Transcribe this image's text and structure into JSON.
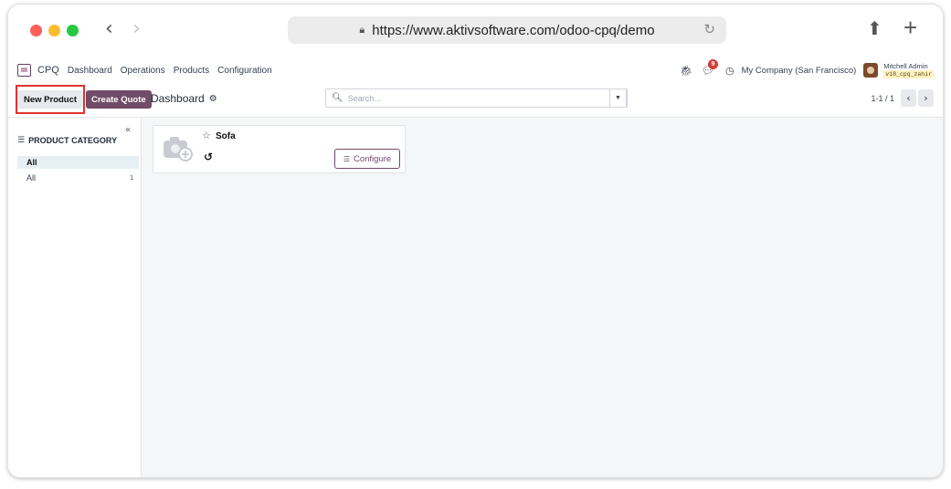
{
  "browser": {
    "url": "https://www.aktivsoftware.com/odoo-cpq/demo"
  },
  "navbar": {
    "app_name": "CPQ",
    "menu": [
      "Dashboard",
      "Operations",
      "Products",
      "Configuration"
    ],
    "chat_badge": "9",
    "company": "My Company (San Francisco)",
    "user_name": "Mitchell Admin",
    "database": "v18_cpq_zahir"
  },
  "control": {
    "new_product_label": "New Product",
    "create_quote_label": "Create Quote",
    "breadcrumb": "Dashboard",
    "search_placeholder": "Search...",
    "pager": "1-1 / 1"
  },
  "sidebar": {
    "title": "PRODUCT CATEGORY",
    "items": [
      {
        "label": "All",
        "count": ""
      },
      {
        "label": "All",
        "count": "1"
      }
    ]
  },
  "products": [
    {
      "name": "Sofa",
      "action_label": "Configure"
    }
  ],
  "icons": [
    "lock-icon",
    "reload-icon",
    "share-icon",
    "plus-icon",
    "bug-icon",
    "chat-icon",
    "clock-icon",
    "gear-icon",
    "search-icon",
    "dropdown-icon",
    "list-icon",
    "collapse-icon",
    "star-icon",
    "camera-icon",
    "history-icon",
    "sliders-icon"
  ],
  "colors": {
    "accent": "#714b67",
    "highlight": "#e03131",
    "badge": "#d23f3a"
  }
}
